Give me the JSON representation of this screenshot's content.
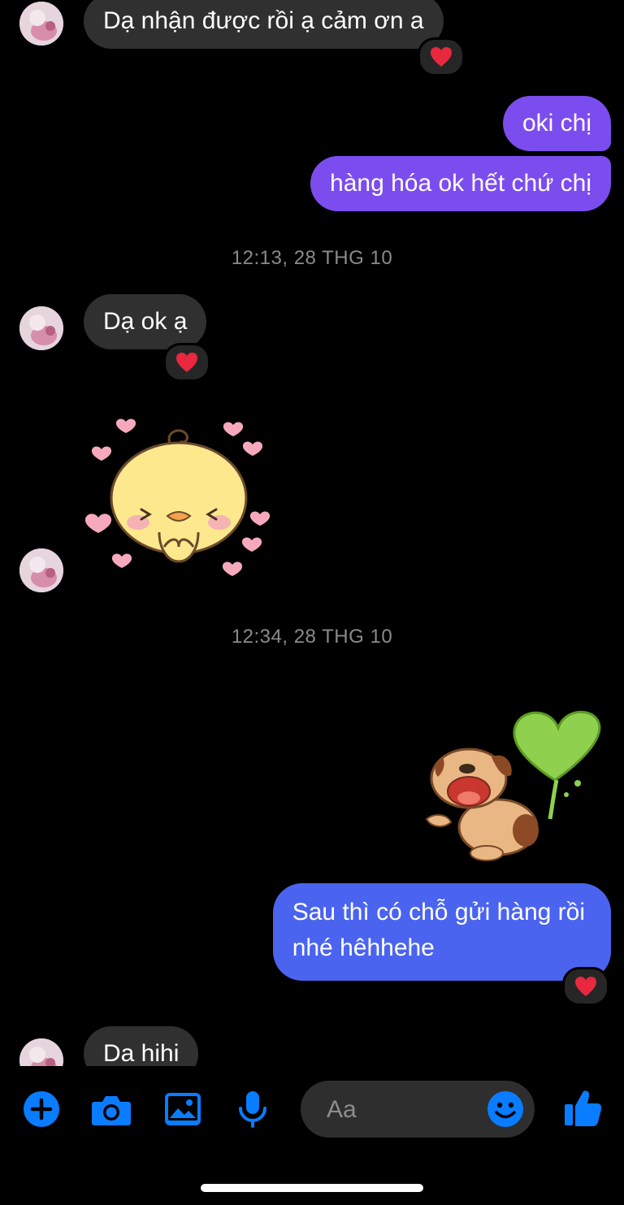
{
  "messages": {
    "m1_text": "Dạ nhận được rồi ạ cảm ơn a",
    "m2_text": "oki chị",
    "m3_text": "hàng hóa ok hết chứ chị",
    "ts1": "12:13, 28 THG 10",
    "m4_text": "Dạ ok ạ",
    "ts2": "12:34, 28 THG 10",
    "m5_text_line1": "Sau thì có chỗ gửi hàng rồi",
    "m5_text_line2": "nhé hêhhehe",
    "m6_text": "Da hihi"
  },
  "reactions": {
    "emoji": "heart"
  },
  "composer": {
    "placeholder": "Aa"
  },
  "icons": {
    "plus": "plus-circle-icon",
    "camera": "camera-icon",
    "gallery": "image-gallery-icon",
    "mic": "microphone-icon",
    "emoji": "emoji-icon",
    "like": "thumbs-up-icon"
  },
  "colors": {
    "accent_blue": "#0a7cff",
    "outgoing_purple": "#7c4dee",
    "outgoing_blue": "#4a64f0",
    "incoming_gray": "#303030"
  }
}
